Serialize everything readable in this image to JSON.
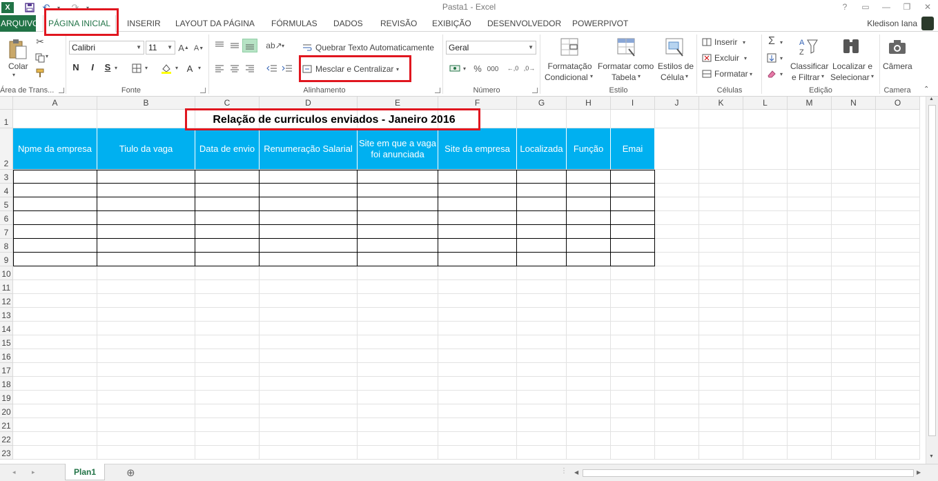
{
  "window": {
    "title": "Pasta1 - Excel",
    "help": "?",
    "controls": [
      "▭",
      "—",
      "❐",
      "✕"
    ]
  },
  "qat": {
    "logo": "X",
    "icons": [
      "save-icon",
      "undo-icon",
      "redo-icon"
    ]
  },
  "tabs": [
    "ARQUIVO",
    "PÁGINA INICIAL",
    "INSERIR",
    "LAYOUT DA PÁGINA",
    "FÓRMULAS",
    "DADOS",
    "REVISÃO",
    "EXIBIÇÃO",
    "DESENVOLVEDOR",
    "POWERPIVOT"
  ],
  "user": "Kledison Iana",
  "ribbon": {
    "clipboard": {
      "paste": "Colar",
      "label": "Área de Trans..."
    },
    "font": {
      "name": "Calibri",
      "size": "11",
      "label": "Fonte",
      "bold": "N",
      "italic": "I",
      "underline": "S"
    },
    "alignment": {
      "wrap": "Quebrar Texto Automaticamente",
      "merge": "Mesclar e Centralizar",
      "label": "Alinhamento"
    },
    "number": {
      "format": "Geral",
      "label": "Número",
      "percent": "%",
      "thousands": "000"
    },
    "styles": {
      "conditional": [
        "Formatação",
        "Condicional"
      ],
      "table": [
        "Formatar como",
        "Tabela"
      ],
      "cell": [
        "Estilos de",
        "Célula"
      ],
      "label": "Estilo"
    },
    "cells": {
      "insert": "Inserir",
      "delete": "Excluir",
      "format": "Formatar",
      "label": "Células"
    },
    "editing": {
      "sort": [
        "Classificar",
        "e Filtrar"
      ],
      "find": [
        "Localizar e",
        "Selecionar"
      ],
      "label": "Edição"
    },
    "camera": {
      "button": "Câmera",
      "label": "Camera"
    }
  },
  "sheet": {
    "columns": [
      "A",
      "B",
      "C",
      "D",
      "E",
      "F",
      "G",
      "H",
      "I",
      "J",
      "K",
      "L",
      "M",
      "N",
      "O"
    ],
    "rows": [
      "1",
      "2",
      "3",
      "4",
      "5",
      "6",
      "7",
      "8",
      "9",
      "10",
      "11",
      "12",
      "13",
      "14",
      "15",
      "16",
      "17",
      "18",
      "19",
      "20",
      "21",
      "22",
      "23"
    ],
    "title": "Relação de curriculos enviados - Janeiro 2016",
    "headers": [
      "Npme da empresa",
      "Tiulo da vaga",
      "Data de envio",
      "Renumeração Salarial",
      "Site em que a vaga foi anunciada",
      "Site da empresa",
      "Localizada",
      "Função",
      "Emai"
    ],
    "sheet_tab": "Plan1",
    "add_sheet": "⊕"
  },
  "colors": {
    "excel_green": "#217346",
    "header_fill": "#00b0f0",
    "highlight": "#e0161f"
  }
}
